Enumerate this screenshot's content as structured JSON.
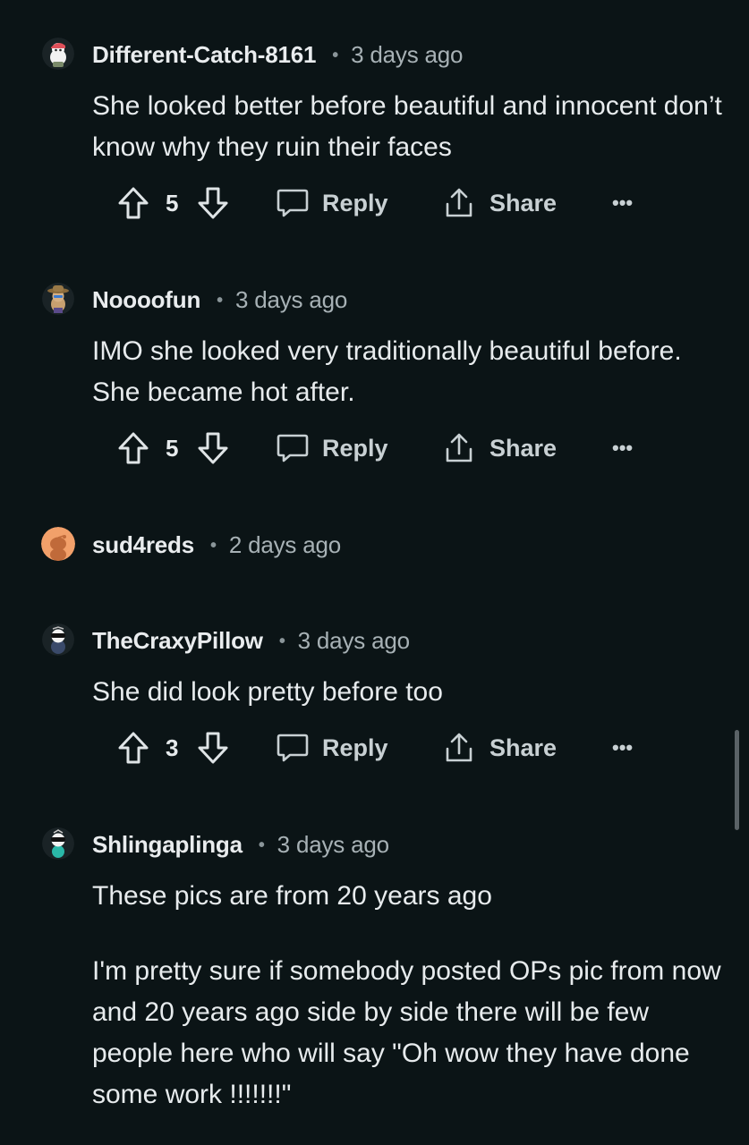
{
  "comments": [
    {
      "username": "Different-Catch-8161",
      "separator": "•",
      "time": "3 days ago",
      "paragraphs": [
        "She looked better before beautiful and innocent don’t know why they ruin their faces"
      ],
      "votes": "5",
      "reply_label": "Reply",
      "share_label": "Share",
      "more_label": "•••",
      "avatar_icon": "snoo-avatar-red-cap"
    },
    {
      "username": "Noooofun",
      "separator": "•",
      "time": "3 days ago",
      "paragraphs": [
        "IMO she looked very traditionally beautiful before. She became hot after."
      ],
      "votes": "5",
      "reply_label": "Reply",
      "share_label": "Share",
      "more_label": "•••",
      "avatar_icon": "snoo-avatar-cowboy-hat"
    },
    {
      "username": "sud4reds",
      "separator": "•",
      "time": "2 days ago",
      "paragraphs": [],
      "avatar_icon": "snoo-avatar-default-orange"
    },
    {
      "username": "TheCraxyPillow",
      "separator": "•",
      "time": "3 days ago",
      "paragraphs": [
        "She did look pretty before too"
      ],
      "votes": "3",
      "reply_label": "Reply",
      "share_label": "Share",
      "more_label": "•••",
      "avatar_icon": "snoo-avatar-sunglasses"
    },
    {
      "username": "Shlingaplinga",
      "separator": "•",
      "time": "3 days ago",
      "paragraphs": [
        "These pics are from 20 years ago",
        "I'm pretty sure if somebody posted OPs pic from now and 20 years ago side by side there will be few people here who will say \"Oh wow they have done some work !!!!!!!\""
      ],
      "avatar_icon": "snoo-avatar-sunglasses-teal"
    }
  ],
  "colors": {
    "background": "#0b1416",
    "text": "#e7ebed",
    "muted": "#a7b1b5",
    "action": "#c8d0d3"
  }
}
